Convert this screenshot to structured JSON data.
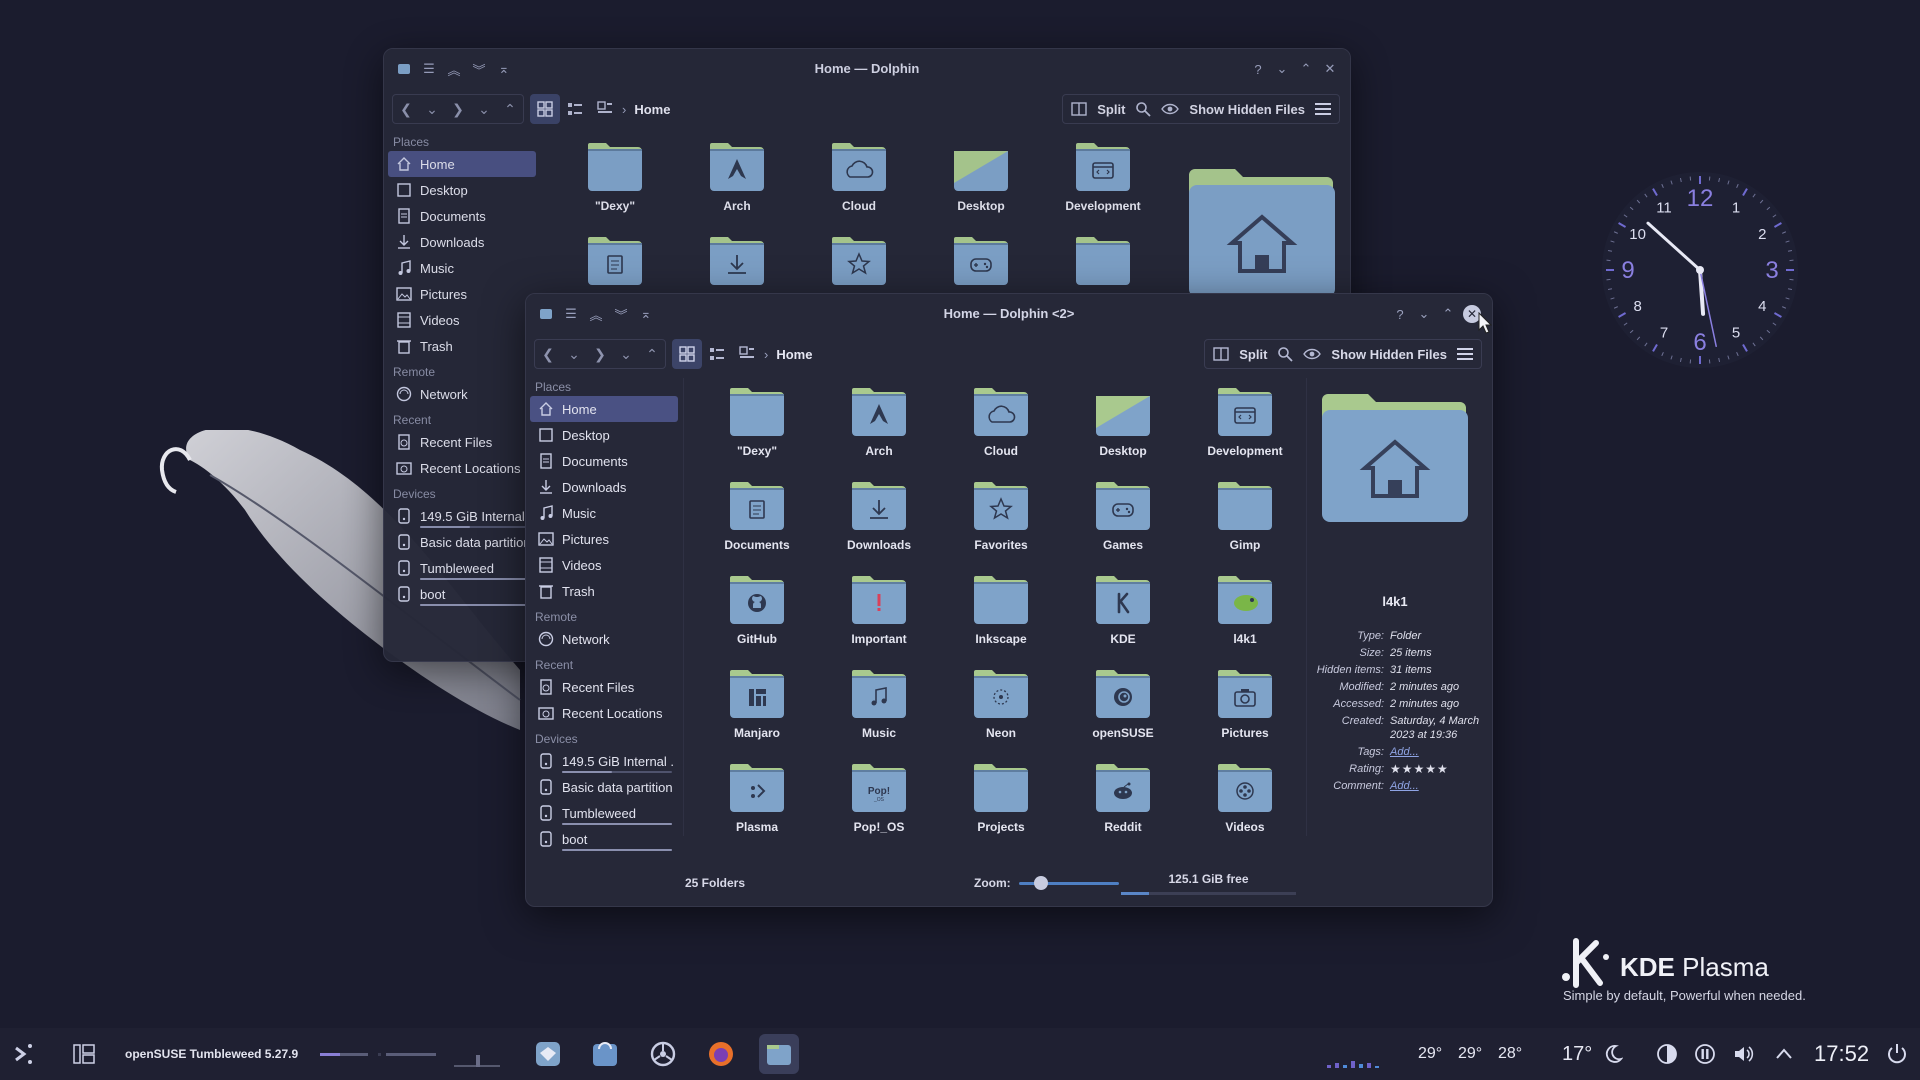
{
  "colors": {
    "accent": "#4a5183",
    "desktop": "#1b1c2e",
    "folder_body": "#7fa3c9",
    "folder_tab": "#a9c98e"
  },
  "window_back": {
    "title": "Home — Dolphin",
    "breadcrumb": "Home",
    "split_label": "Split",
    "hidden_label": "Show Hidden Files",
    "folders": [
      {
        "label": "\"Dexy\"",
        "emblem": "none"
      },
      {
        "label": "Arch",
        "emblem": "arch"
      },
      {
        "label": "Cloud",
        "emblem": "cloud"
      },
      {
        "label": "Desktop",
        "emblem": "desktop"
      },
      {
        "label": "Development",
        "emblem": "dev"
      },
      {
        "label": "",
        "emblem": "doc"
      },
      {
        "label": "",
        "emblem": "download"
      },
      {
        "label": "",
        "emblem": "star"
      },
      {
        "label": "",
        "emblem": "game"
      },
      {
        "label": "",
        "emblem": "none"
      }
    ]
  },
  "window_front": {
    "title": "Home — Dolphin <2>",
    "breadcrumb": "Home",
    "split_label": "Split",
    "hidden_label": "Show Hidden Files",
    "status_count": "25 Folders",
    "zoom_label": "Zoom:",
    "zoom_level": 0.22,
    "free_space": "125.1 GiB free",
    "free_used_fraction": 0.16,
    "folders": [
      {
        "label": "\"Dexy\"",
        "emblem": "none"
      },
      {
        "label": "Arch",
        "emblem": "arch"
      },
      {
        "label": "Cloud",
        "emblem": "cloud"
      },
      {
        "label": "Desktop",
        "emblem": "desktop"
      },
      {
        "label": "Development",
        "emblem": "dev"
      },
      {
        "label": "Documents",
        "emblem": "doc"
      },
      {
        "label": "Downloads",
        "emblem": "download"
      },
      {
        "label": "Favorites",
        "emblem": "star"
      },
      {
        "label": "Games",
        "emblem": "game"
      },
      {
        "label": "Gimp",
        "emblem": "none"
      },
      {
        "label": "GitHub",
        "emblem": "github"
      },
      {
        "label": "Important",
        "emblem": "important"
      },
      {
        "label": "Inkscape",
        "emblem": "none"
      },
      {
        "label": "KDE",
        "emblem": "kde"
      },
      {
        "label": "l4k1",
        "emblem": "gecko"
      },
      {
        "label": "Manjaro",
        "emblem": "manjaro"
      },
      {
        "label": "Music",
        "emblem": "music"
      },
      {
        "label": "Neon",
        "emblem": "neon"
      },
      {
        "label": "openSUSE",
        "emblem": "suse"
      },
      {
        "label": "Pictures",
        "emblem": "camera"
      },
      {
        "label": "Plasma",
        "emblem": "plasma"
      },
      {
        "label": "Pop!_OS",
        "emblem": "pop"
      },
      {
        "label": "Projects",
        "emblem": "none"
      },
      {
        "label": "Reddit",
        "emblem": "reddit"
      },
      {
        "label": "Videos",
        "emblem": "video"
      }
    ],
    "info": {
      "name": "l4k1",
      "rows": [
        {
          "k": "Type:",
          "v": "Folder",
          "link": false
        },
        {
          "k": "Size:",
          "v": "25 items",
          "link": false
        },
        {
          "k": "Hidden items:",
          "v": "31 items",
          "link": false
        },
        {
          "k": "Modified:",
          "v": "2 minutes ago",
          "link": false
        },
        {
          "k": "Accessed:",
          "v": "2 minutes ago",
          "link": false
        },
        {
          "k": "Created:",
          "v": "Saturday, 4 March 2023 at 19:36",
          "link": false
        },
        {
          "k": "Tags:",
          "v": "Add...",
          "link": true
        },
        {
          "k": "Rating:",
          "v": "",
          "link": false,
          "stars": 5
        },
        {
          "k": "Comment:",
          "v": "Add...",
          "link": true
        }
      ]
    }
  },
  "places": {
    "heads": {
      "places": "Places",
      "remote": "Remote",
      "recent": "Recent",
      "devices": "Devices"
    },
    "places_items": [
      {
        "label": "Home",
        "icon": "home-icon",
        "active": true
      },
      {
        "label": "Desktop",
        "icon": "desktop-icon"
      },
      {
        "label": "Documents",
        "icon": "documents-icon"
      },
      {
        "label": "Downloads",
        "icon": "downloads-icon"
      },
      {
        "label": "Music",
        "icon": "music-icon"
      },
      {
        "label": "Pictures",
        "icon": "pictures-icon"
      },
      {
        "label": "Videos",
        "icon": "videos-icon"
      },
      {
        "label": "Trash",
        "icon": "trash-icon"
      }
    ],
    "remote_items": [
      {
        "label": "Network",
        "icon": "network-icon"
      }
    ],
    "recent_items": [
      {
        "label": "Recent Files",
        "icon": "recent-files-icon"
      },
      {
        "label": "Recent Locations",
        "icon": "recent-locations-icon"
      }
    ],
    "device_items": [
      {
        "label": "149.5 GiB Internal ...",
        "icon": "drive-icon",
        "usage": 0.45
      },
      {
        "label": "Basic data partition",
        "icon": "drive-icon"
      },
      {
        "label": "Tumbleweed",
        "icon": "drive-icon",
        "usage": 1.0
      },
      {
        "label": "boot",
        "icon": "drive-icon",
        "usage": 1.0
      }
    ]
  },
  "clock": {
    "hour_numbers": [
      "12",
      "1",
      "2",
      "3",
      "4",
      "5",
      "6",
      "7",
      "8",
      "9",
      "10",
      "11"
    ],
    "hours": 17,
    "minutes": 52,
    "seconds": 28
  },
  "branding": {
    "kde": "KDE",
    "plasma": "Plasma",
    "slogan": "Simple by default, Powerful when needed."
  },
  "taskbar": {
    "distro": "openSUSE Tumbleweed 5.27.9",
    "temps": [
      "29°",
      "29°",
      "28°"
    ],
    "weather": "17°",
    "time": "17:52"
  }
}
